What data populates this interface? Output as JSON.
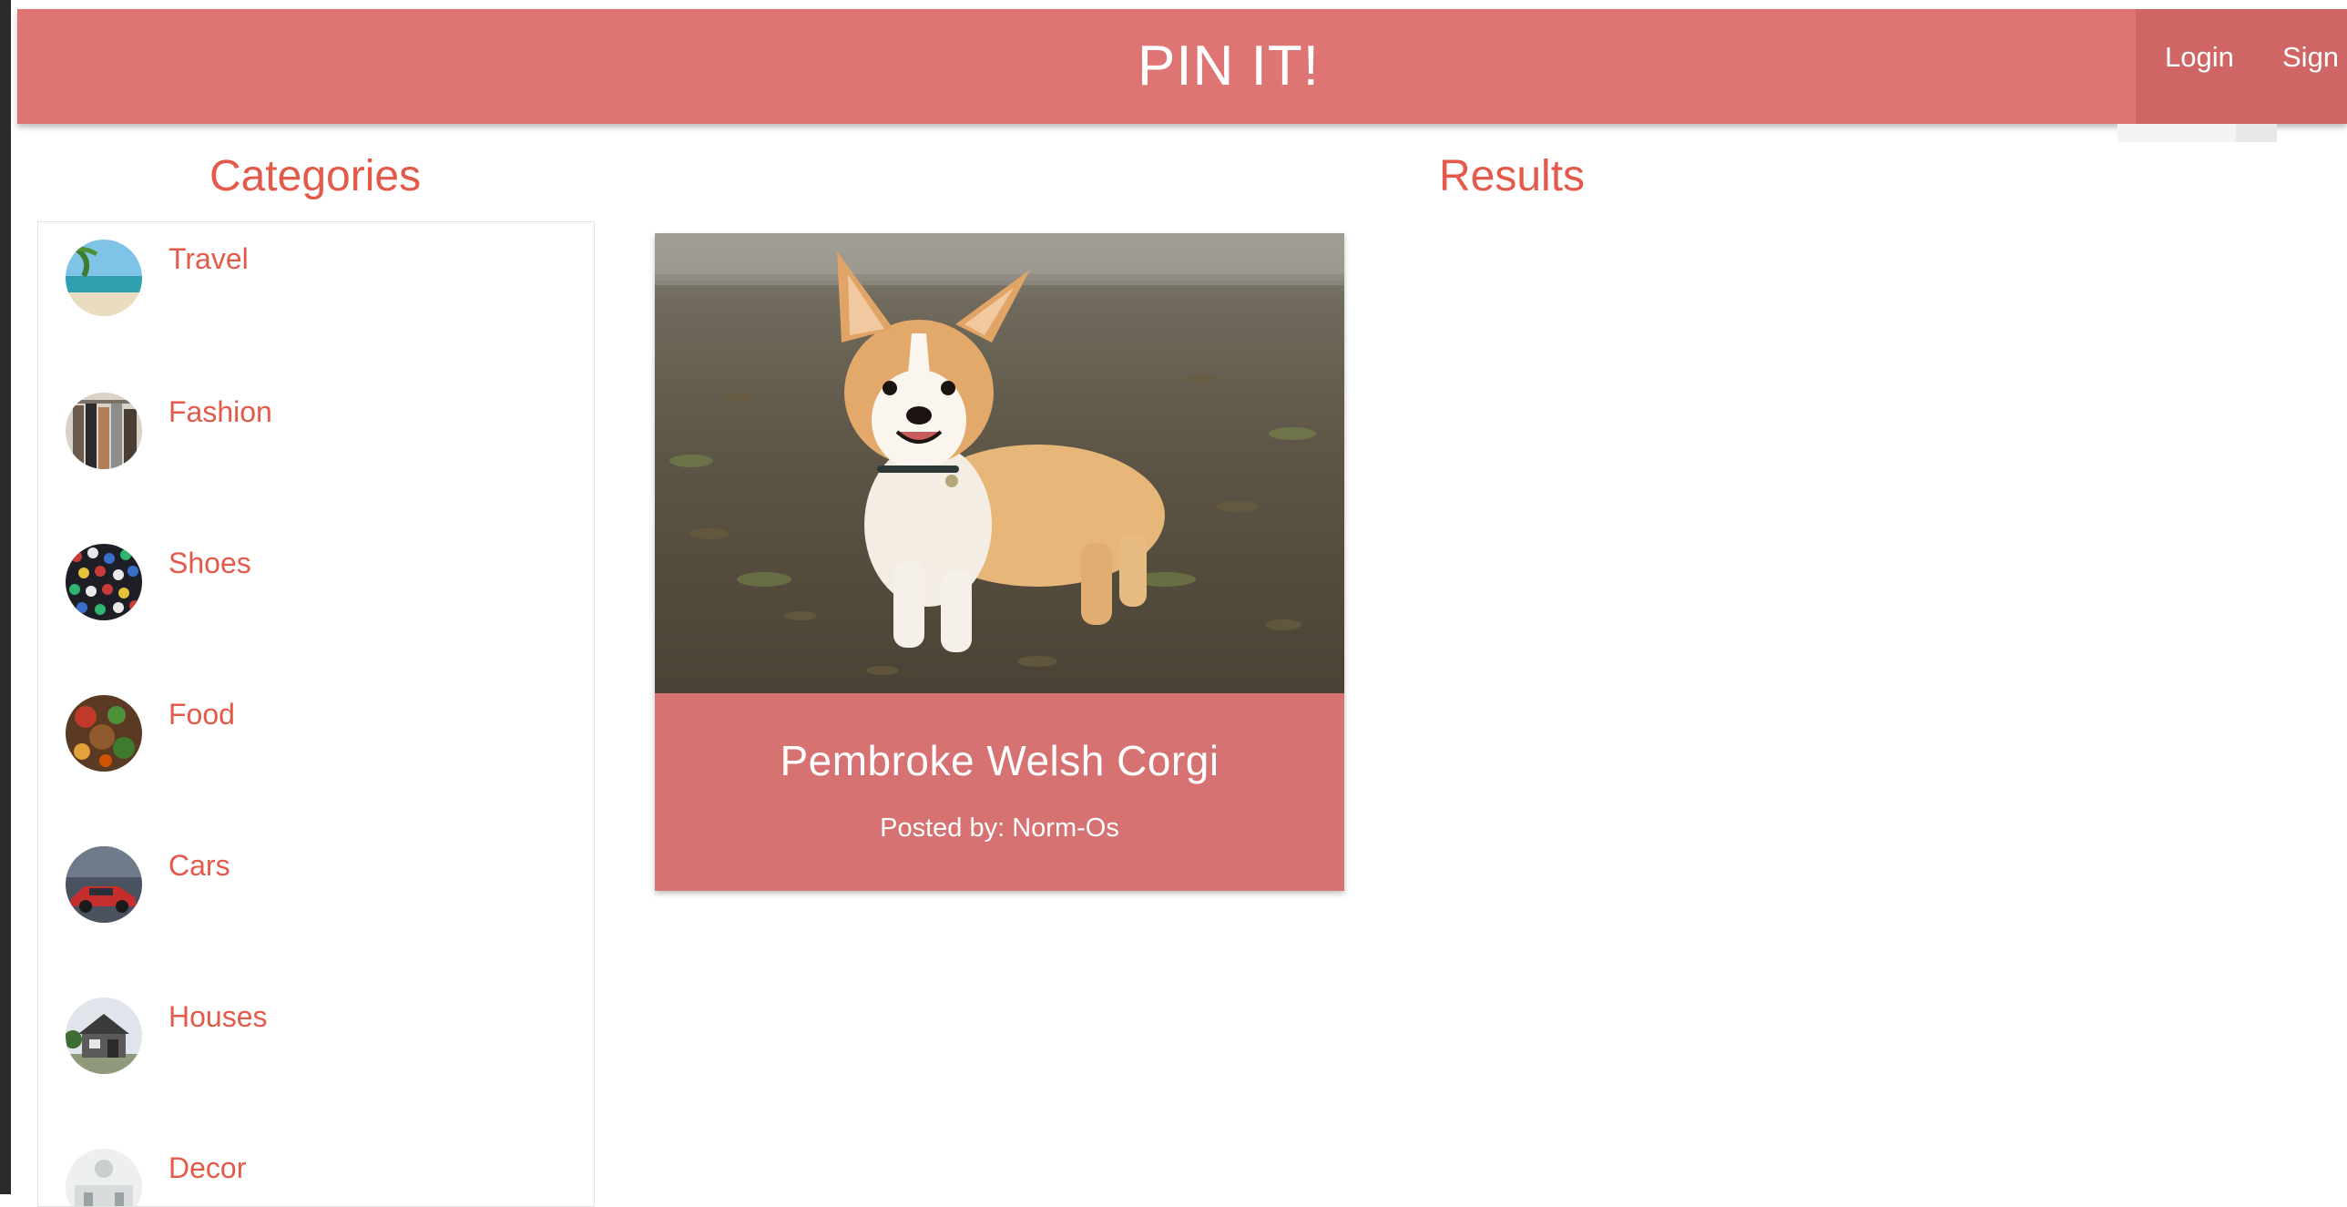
{
  "header": {
    "brand": "PIN IT!",
    "nav": {
      "login_label": "Login",
      "sign_label": "Sign"
    },
    "background_color": "#df7474"
  },
  "categories": {
    "heading": "Categories",
    "items": [
      {
        "label": "Travel",
        "icon": "travel-thumbnail"
      },
      {
        "label": "Fashion",
        "icon": "fashion-thumbnail"
      },
      {
        "label": "Shoes",
        "icon": "shoes-thumbnail"
      },
      {
        "label": "Food",
        "icon": "food-thumbnail"
      },
      {
        "label": "Cars",
        "icon": "cars-thumbnail"
      },
      {
        "label": "Houses",
        "icon": "houses-thumbnail"
      },
      {
        "label": "Decor",
        "icon": "decor-thumbnail"
      }
    ],
    "accent_color": "#e45a4a"
  },
  "results": {
    "heading": "Results",
    "cards": [
      {
        "title": "Pembroke Welsh Corgi",
        "posted_by_label": "Posted by:",
        "author": "Norm-Os",
        "image": "corgi-photo",
        "card_color": "#d67372"
      }
    ]
  }
}
